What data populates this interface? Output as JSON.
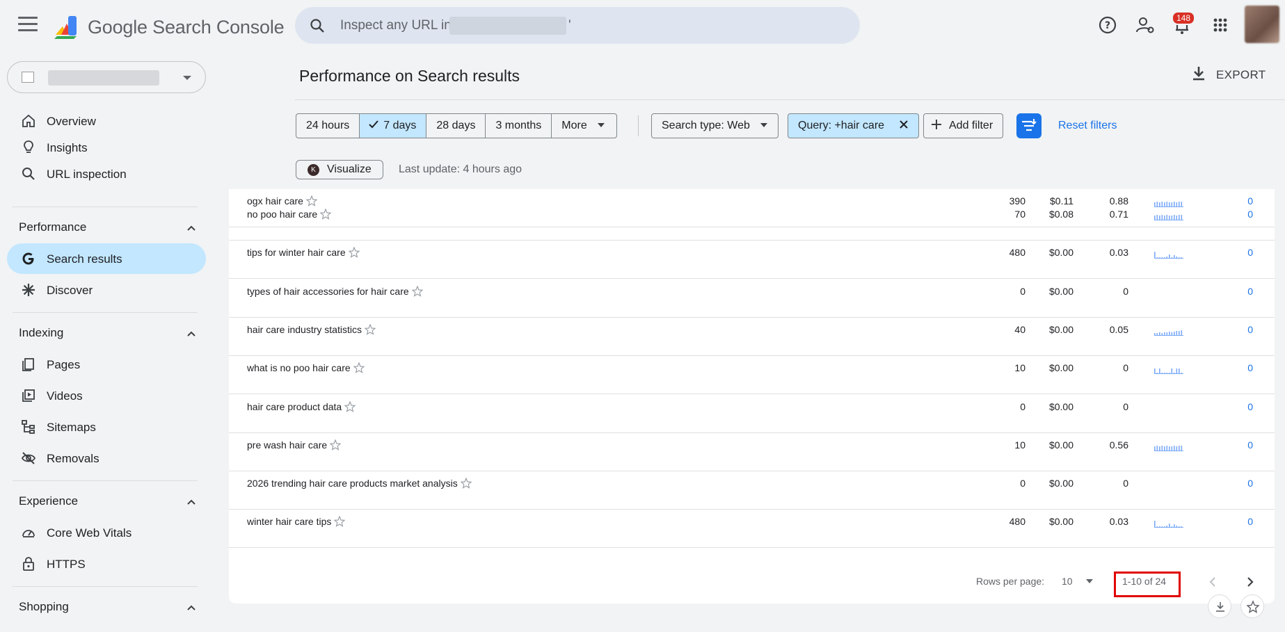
{
  "app": {
    "brand": "Google Search Console"
  },
  "search": {
    "placeholder": "Inspect any URL in '",
    "placeholder_end": "'"
  },
  "notifications": {
    "count": "148"
  },
  "sidebar": {
    "overview": "Overview",
    "insights": "Insights",
    "url_inspection": "URL inspection",
    "performance_header": "Performance",
    "search_results": "Search results",
    "discover": "Discover",
    "indexing_header": "Indexing",
    "pages": "Pages",
    "videos": "Videos",
    "sitemaps": "Sitemaps",
    "removals": "Removals",
    "experience_header": "Experience",
    "core_web_vitals": "Core Web Vitals",
    "https": "HTTPS",
    "shopping_header": "Shopping"
  },
  "main": {
    "title": "Performance on Search results",
    "export_label": "EXPORT",
    "date_ranges": [
      "24 hours",
      "7 days",
      "28 days",
      "3 months",
      "More"
    ],
    "selected_date_range": "7 days",
    "search_type_chip": "Search type: Web",
    "query_chip": "Query: +hair care",
    "add_filter": "Add filter",
    "reset_filters": "Reset filters",
    "visualize": "Visualize",
    "visualize_badge": "K",
    "last_update": "Last update: 4 hours ago"
  },
  "table": {
    "rows": [
      {
        "query": "ogx hair care",
        "volume": "390",
        "cpc": "$0.11",
        "score": "0.88",
        "trend": "flat",
        "link": "0"
      },
      {
        "query": "no poo hair care",
        "volume": "70",
        "cpc": "$0.08",
        "score": "0.71",
        "trend": "flat",
        "link": "0"
      },
      {
        "query": "tips for winter hair care",
        "volume": "480",
        "cpc": "$0.00",
        "score": "0.03",
        "trend": "sparse",
        "link": "0"
      },
      {
        "query": "types of hair accessories for hair care",
        "volume": "0",
        "cpc": "$0.00",
        "score": "0",
        "trend": "none",
        "link": "0"
      },
      {
        "query": "hair care industry statistics",
        "volume": "40",
        "cpc": "$0.00",
        "score": "0.05",
        "trend": "rising",
        "link": "0"
      },
      {
        "query": "what is no poo hair care",
        "volume": "10",
        "cpc": "$0.00",
        "score": "0",
        "trend": "spiky",
        "link": "0"
      },
      {
        "query": "hair care product data",
        "volume": "0",
        "cpc": "$0.00",
        "score": "0",
        "trend": "none",
        "link": "0"
      },
      {
        "query": "pre wash hair care",
        "volume": "10",
        "cpc": "$0.00",
        "score": "0.56",
        "trend": "flat",
        "link": "0"
      },
      {
        "query": "2026 trending hair care products market analysis",
        "volume": "0",
        "cpc": "$0.00",
        "score": "0",
        "trend": "none",
        "link": "0"
      },
      {
        "query": "winter hair care tips",
        "volume": "480",
        "cpc": "$0.00",
        "score": "0.03",
        "trend": "sparse",
        "link": "0"
      }
    ],
    "rows_per_page_label": "Rows per page:",
    "rows_per_page_value": "10",
    "range_label": "1-10 of 24"
  },
  "colors": {
    "accent": "#1a73e8",
    "selected_bg": "#c2e7ff",
    "highlight": "#e00000"
  }
}
